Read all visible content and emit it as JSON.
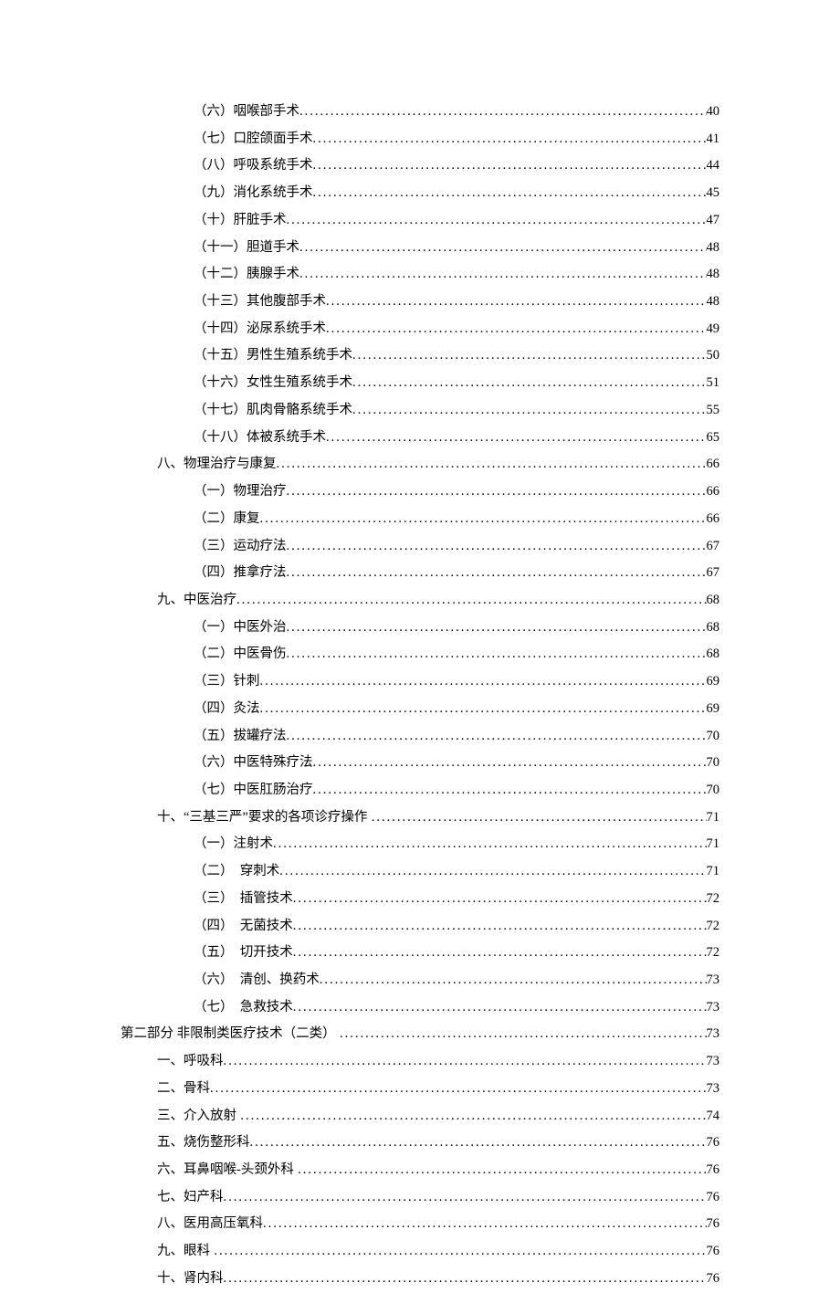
{
  "toc": [
    {
      "level": 3,
      "label": "（六）咽喉部手术",
      "page": "40"
    },
    {
      "level": 3,
      "label": "（七）口腔颌面手术",
      "page": "41"
    },
    {
      "level": 3,
      "label": "（八）呼吸系统手术",
      "page": "44"
    },
    {
      "level": 3,
      "label": "（九）消化系统手术",
      "page": "45"
    },
    {
      "level": 3,
      "label": "（十）肝脏手术",
      "page": "47"
    },
    {
      "level": 3,
      "label": "（十一）胆道手术",
      "page": "48"
    },
    {
      "level": 3,
      "label": "（十二）胰腺手术",
      "page": "48"
    },
    {
      "level": 3,
      "label": "（十三）其他腹部手术",
      "page": "48"
    },
    {
      "level": 3,
      "label": "（十四）泌尿系统手术",
      "page": "49"
    },
    {
      "level": 3,
      "label": "（十五）男性生殖系统手术",
      "page": "50"
    },
    {
      "level": 3,
      "label": "（十六）女性生殖系统手术",
      "page": "51"
    },
    {
      "level": 3,
      "label": "（十七）肌肉骨骼系统手术",
      "page": "55"
    },
    {
      "level": 3,
      "label": "（十八）体被系统手术",
      "page": "65"
    },
    {
      "level": 2,
      "label": "八、物理治疗与康复",
      "page": "66"
    },
    {
      "level": 3,
      "label": "（一）物理治疗",
      "page": "66"
    },
    {
      "level": 3,
      "label": "（二）康复",
      "page": "66"
    },
    {
      "level": 3,
      "label": "（三）运动疗法",
      "page": "67"
    },
    {
      "level": 3,
      "label": "（四）推拿疗法",
      "page": "67"
    },
    {
      "level": 2,
      "label": "九、中医治疗",
      "page": "68"
    },
    {
      "level": 3,
      "label": "（一）中医外治",
      "page": "68"
    },
    {
      "level": 3,
      "label": "（二）中医骨伤",
      "page": "68"
    },
    {
      "level": 3,
      "label": "（三）针刺",
      "page": "69"
    },
    {
      "level": 3,
      "label": "（四）灸法",
      "page": "69"
    },
    {
      "level": 3,
      "label": "（五）拔罐疗法",
      "page": "70"
    },
    {
      "level": 3,
      "label": "（六）中医特殊疗法",
      "page": "70"
    },
    {
      "level": 3,
      "label": "（七）中医肛肠治疗",
      "page": "70"
    },
    {
      "level": 2,
      "label": "十、“三基三严”要求的各项诊疗操作",
      "gap": true,
      "page": "71"
    },
    {
      "level": 3,
      "label": "（一）注射术",
      "page": "71"
    },
    {
      "level": 3,
      "label": "（二）　穿刺术",
      "page": "71"
    },
    {
      "level": 3,
      "label": "（三）　插管技术",
      "page": "72"
    },
    {
      "level": 3,
      "label": "（四）　无菌技术",
      "page": "72"
    },
    {
      "level": 3,
      "label": "（五）　切开技术",
      "page": "72"
    },
    {
      "level": 3,
      "label": "（六）　清创、换药术",
      "page": "73"
    },
    {
      "level": 3,
      "label": "（七）　急救技术",
      "page": "73"
    },
    {
      "level": 1,
      "label": "第二部分 非限制类医疗技术（二类）",
      "gap": true,
      "page": "73"
    },
    {
      "level": 2,
      "label": "一、呼吸科",
      "page": "73"
    },
    {
      "level": 2,
      "label": "二、骨科",
      "page": "73"
    },
    {
      "level": 2,
      "label": "三、介入放射",
      "gap": true,
      "page": "74"
    },
    {
      "level": 2,
      "label": "五、烧伤整形科",
      "page": "76"
    },
    {
      "level": 2,
      "label": "六、耳鼻咽喉-头颈外科",
      "gap": true,
      "page": "76"
    },
    {
      "level": 2,
      "label": "七、妇产科",
      "page": "76"
    },
    {
      "level": 2,
      "label": "八、医用高压氧科",
      "page": "76"
    },
    {
      "level": 2,
      "label": "九、眼科",
      "gap": true,
      "page": "76"
    },
    {
      "level": 2,
      "label": "十、肾内科",
      "page": "76"
    }
  ]
}
